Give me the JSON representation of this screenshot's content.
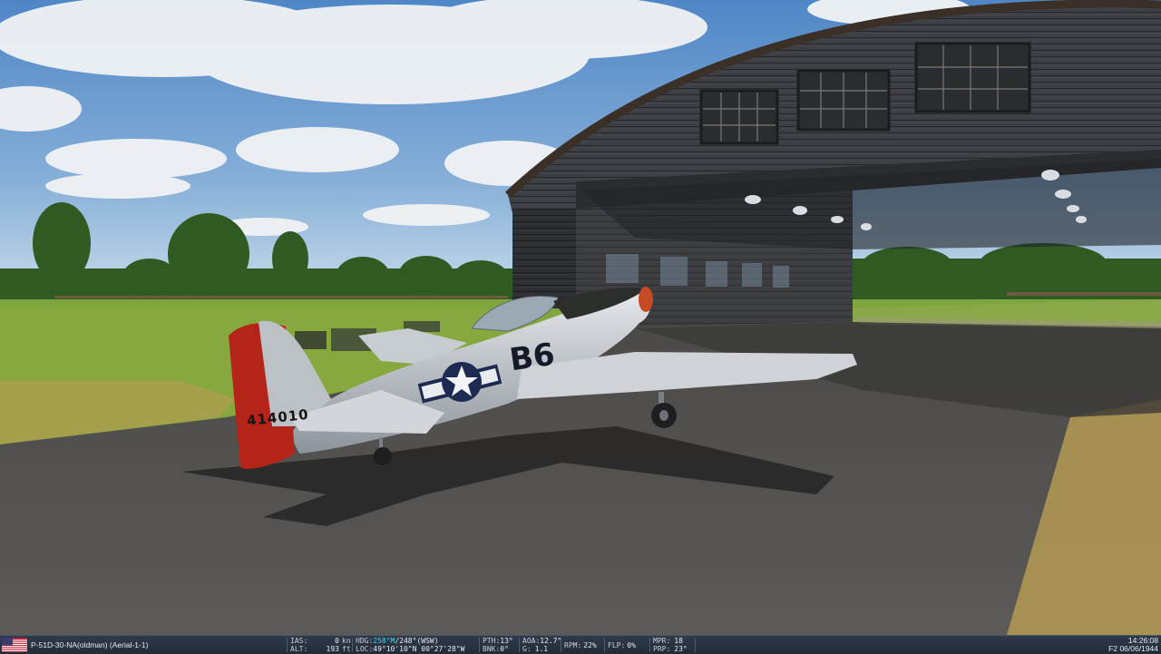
{
  "hud": {
    "aircraft": "P-51D-30-NA(oldman) (Aerial-1-1)",
    "ias_label": "IAS:",
    "ias_value": "0",
    "ias_unit": "kn",
    "alt_label": "ALT:",
    "alt_value": "193",
    "alt_unit": "ft",
    "hdg_label": "HDG:",
    "hdg_mag": "258°M",
    "hdg_true": "/248°(WSW)",
    "loc_label": "LOC:",
    "loc_value": "49°10'10\"N 00°27'28\"W",
    "pth_label": "PTH:",
    "pth_value": "13°",
    "bnk_label": "BNK:",
    "bnk_value": "0°",
    "aoa_label": "AOA:",
    "aoa_value": "12.7°",
    "g_label": "G:",
    "g_value": "1.1",
    "rpm_label": "RPM:",
    "rpm_value": "22%",
    "flp_label": "FLP:",
    "flp_value": "0%",
    "mpr_label": "MPR:",
    "mpr_value": "18",
    "prp_label": "PRP:",
    "prp_value": "23°",
    "time": "14:26:08",
    "date": "F2 06/06/1944"
  },
  "aircraft_markings": {
    "code": "B6",
    "serial": "414010"
  },
  "colors": {
    "hud_highlight": "#3fd0e8",
    "hud_bg": "#26303e",
    "tail_red": "#b52418"
  },
  "icons": {
    "flag": "us-flag-icon"
  }
}
